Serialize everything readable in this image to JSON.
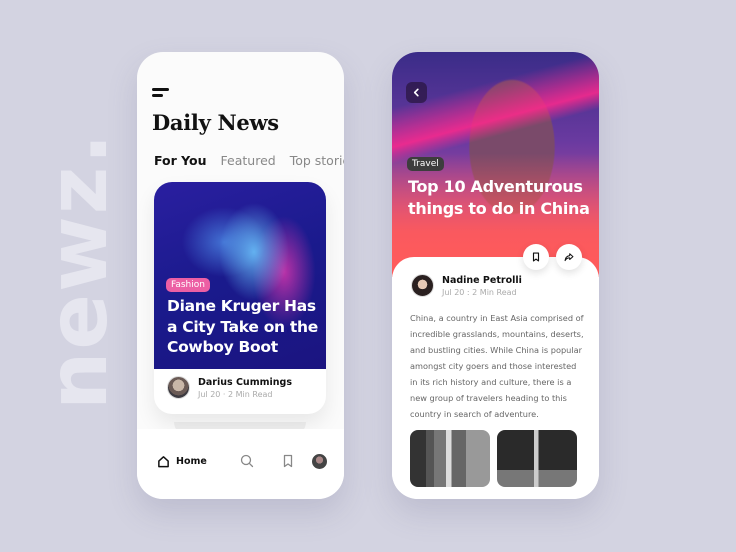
{
  "brand": {
    "wordmark": "newz."
  },
  "feed_screen": {
    "title": "Daily News",
    "tabs": [
      {
        "label": "For You",
        "active": true
      },
      {
        "label": "Featured",
        "active": false
      },
      {
        "label": "Top stories",
        "active": false
      }
    ],
    "featured_card": {
      "tag": "Fashion",
      "title": "Diane Kruger Has a City Take on the Cowboy Boot",
      "author": "Darius Cummings",
      "meta": "Jul 20 · 2 Min Read"
    },
    "bottom_nav": {
      "home_label": "Home",
      "icons": [
        "home-icon",
        "search-icon",
        "bookmark-icon",
        "profile-avatar"
      ]
    }
  },
  "article_screen": {
    "tag": "Travel",
    "title": "Top 10 Adventurous things to do in China",
    "author": "Nadine Petrolli",
    "meta": "Jul 20 : 2 Min Read",
    "body": "China, a country in East Asia comprised of incredible grasslands, mountains, deserts, and bustling cities. While China is popular amongst city goers and those interested in its rich history and culture, there is a new group of travelers heading to this country in search of adventure.",
    "actions": [
      "bookmark-icon",
      "share-icon"
    ]
  },
  "colors": {
    "background": "#d3d3e1",
    "fashion_tag": "#ec5fa4",
    "travel_tag": "#3d3d3d",
    "text_primary": "#111111",
    "text_muted": "#888888"
  }
}
